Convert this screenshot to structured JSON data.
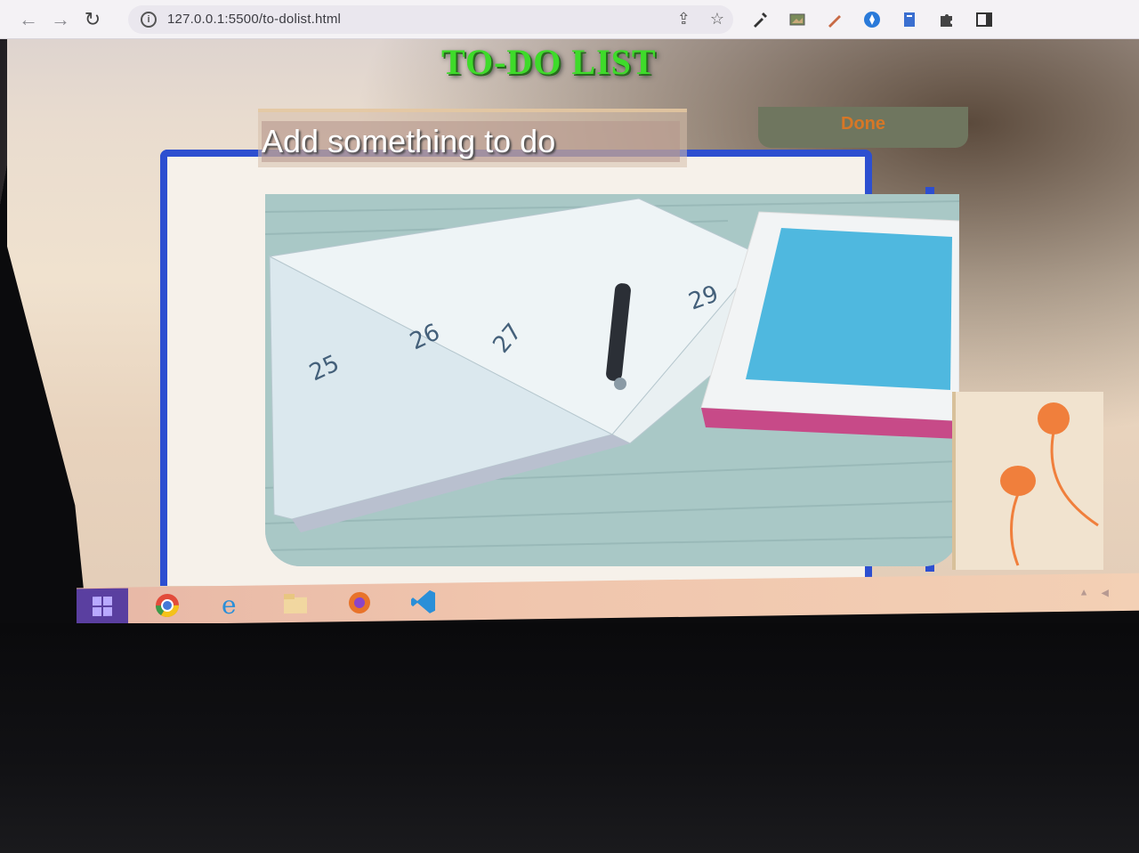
{
  "browser": {
    "url": "127.0.0.1:5500/to-dolist.html",
    "back_icon": "←",
    "forward_icon": "→",
    "reload_icon": "↻",
    "info_icon": "i",
    "share_icon": "⇪",
    "star_icon": "☆"
  },
  "page": {
    "title": "TO-DO LIST",
    "input_placeholder": "Add something to do",
    "done_label": "Done"
  },
  "taskbar": {
    "items": [
      "start",
      "chrome",
      "internet-explorer",
      "file-explorer",
      "firefox",
      "vscode"
    ]
  },
  "colors": {
    "title_green": "#3edb2a",
    "done_text": "#d77726",
    "done_bg": "#6f765f",
    "frame_blue": "#2d4fd0"
  }
}
